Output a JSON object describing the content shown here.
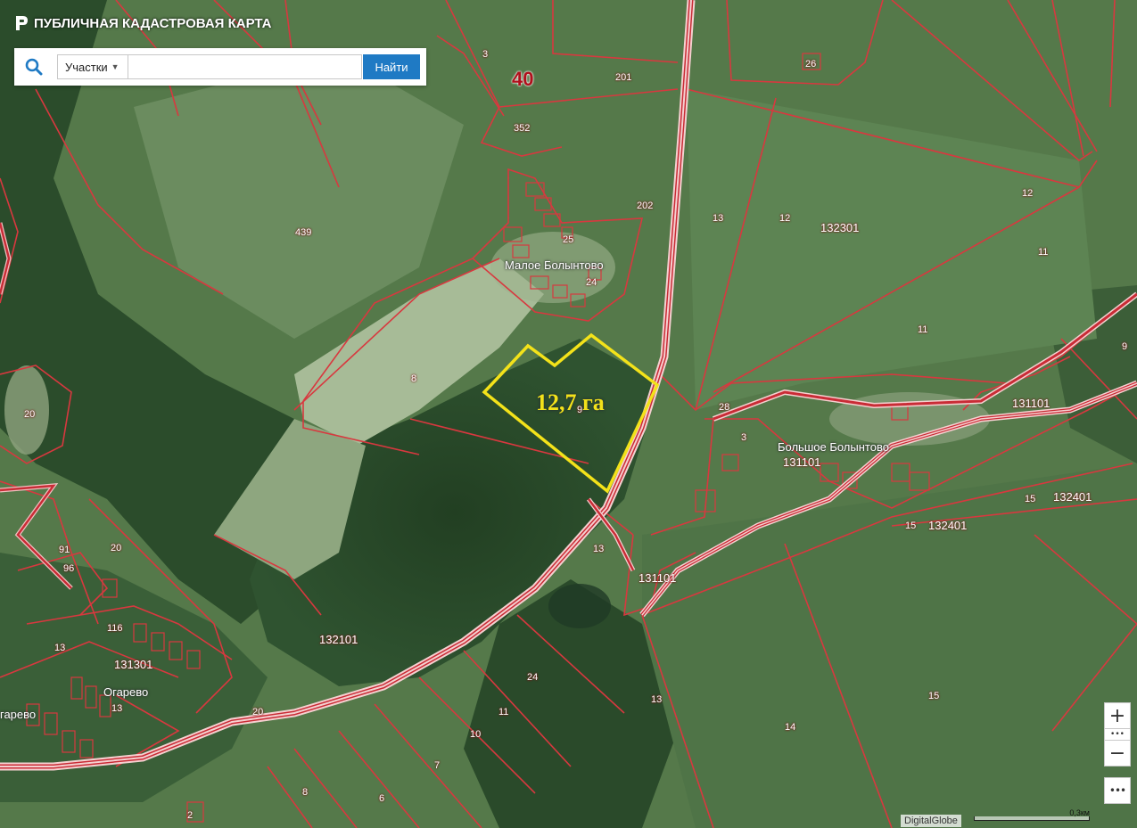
{
  "app": {
    "title": "ПУБЛИЧНАЯ КАДАСТРОВАЯ КАРТА",
    "logo_icon": "pkk-logo-icon"
  },
  "search": {
    "icon": "search-icon",
    "type_selected": "Участки",
    "query": "",
    "placeholder": "",
    "button_label": "Найти"
  },
  "map": {
    "highlight_area": "12,7 га",
    "quarter_number": "40",
    "settlements": [
      "Малое Болынтово",
      "Большое Болынтово",
      "Огарево",
      "гарево"
    ],
    "quarters": [
      "132301",
      "132401",
      "132401",
      "131101",
      "131101",
      "131101",
      "132101",
      "131301"
    ],
    "parcels": [
      "3",
      "201",
      "352",
      "202",
      "439",
      "13",
      "12",
      "12",
      "11",
      "11",
      "8",
      "9",
      "20",
      "28",
      "3",
      "9",
      "15",
      "15",
      "13",
      "20",
      "91",
      "96",
      "116",
      "13",
      "24",
      "11",
      "10",
      "7",
      "13",
      "14",
      "15",
      "20",
      "8",
      "6",
      "25",
      "24",
      "26",
      "13",
      "2"
    ],
    "colors": {
      "boundary": "#d8383f",
      "highlight": "#f3e21a",
      "road": "#f2c9c9"
    }
  },
  "controls": {
    "zoom_in": "+",
    "zoom_dots": "•••",
    "zoom_out": "−",
    "more": "•••"
  },
  "attribution": "DigitalGlobe",
  "scale_label": "0,3км"
}
